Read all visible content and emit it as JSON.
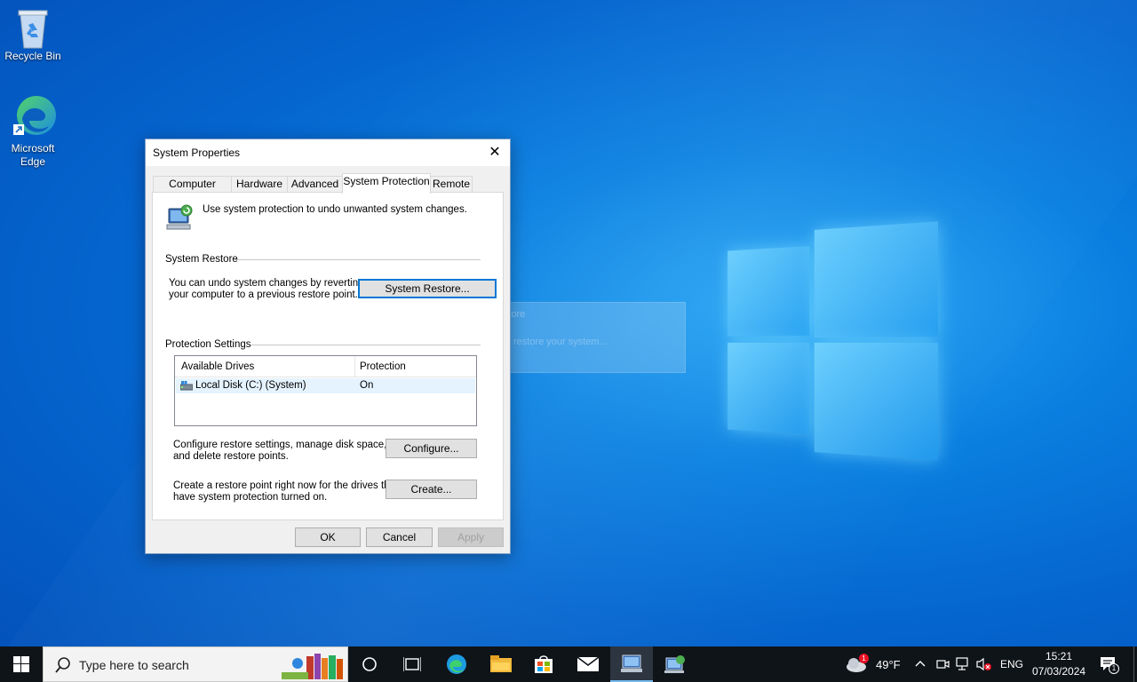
{
  "desktop": {
    "icons": [
      {
        "label": "Recycle Bin",
        "icon": "recycle-bin-icon"
      },
      {
        "label": "Microsoft\nEdge",
        "label_line1": "Microsoft",
        "label_line2": "Edge",
        "icon": "edge-icon"
      }
    ],
    "ghost_dialog": {
      "title": "System Restore",
      "message": "Preparing to restore your system..."
    }
  },
  "dialog": {
    "title": "System Properties",
    "close_glyph": "✕",
    "tabs": [
      {
        "label": "Computer Name"
      },
      {
        "label": "Hardware"
      },
      {
        "label": "Advanced"
      },
      {
        "label": "System Protection",
        "active": true
      },
      {
        "label": "Remote"
      }
    ],
    "intro": "Use system protection to undo unwanted system changes.",
    "system_restore": {
      "group_label": "System Restore",
      "description_line1": "You can undo system changes by reverting",
      "description_line2": "your computer to a previous restore point.",
      "button": "System Restore..."
    },
    "protection_settings": {
      "group_label": "Protection Settings",
      "columns": [
        "Available Drives",
        "Protection"
      ],
      "rows": [
        {
          "drive": "Local Disk (C:) (System)",
          "protection": "On"
        }
      ],
      "configure_text_line1": "Configure restore settings, manage disk space,",
      "configure_text_line2": "and delete restore points.",
      "configure_button": "Configure...",
      "create_text_line1": "Create a restore point right now for the drives that",
      "create_text_line2": "have system protection turned on.",
      "create_button": "Create..."
    },
    "footer": {
      "ok": "OK",
      "cancel": "Cancel",
      "apply": "Apply"
    }
  },
  "taskbar": {
    "search_placeholder": "Type here to search",
    "weather_temp": "49°F",
    "weather_badge": "1",
    "language": "ENG",
    "time": "15:21",
    "date": "07/03/2024",
    "notification_count": "1"
  },
  "colors": {
    "accent": "#0078d7",
    "taskbar": "#0f1419",
    "dialog_bg": "#f0f0f0"
  }
}
